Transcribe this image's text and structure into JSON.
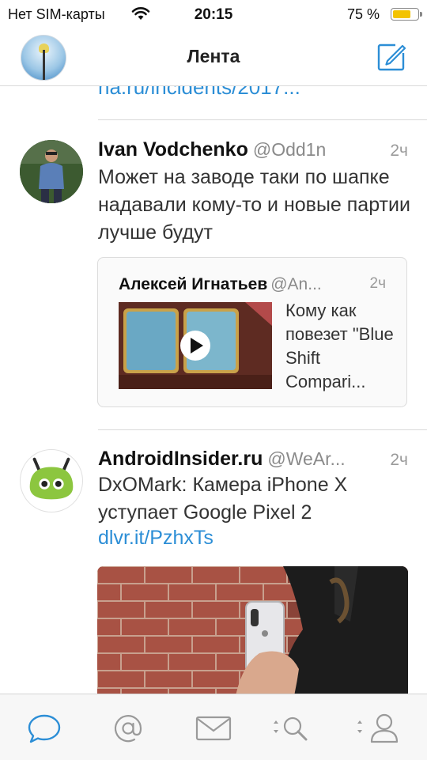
{
  "status_bar": {
    "carrier": "Нет SIM-карты",
    "time": "20:15",
    "battery_percent": "75 %",
    "battery_level": 0.75
  },
  "nav": {
    "title": "Лента"
  },
  "feed": {
    "previous_link": "na.ru/incidents/2017...",
    "tweets": [
      {
        "name": "Ivan Vodchenko",
        "handle": "@Odd1n",
        "time": "2ч",
        "text": "Может на заводе таки по шапке надавали кому-то и новые партии лучше будут",
        "quote": {
          "name": "Алексей Игнатьев",
          "handle": "@An...",
          "time": "2ч",
          "text": "Кому как повезет \"Blue Shift Compari..."
        }
      },
      {
        "name": "AndroidInsider.ru",
        "handle": "@WeAr...",
        "time": "2ч",
        "text": "DxOMark: Камера iPhone X уступает Google Pixel 2",
        "link": "dlvr.it/PzhxTs"
      }
    ]
  },
  "tab_bar": {
    "tabs": [
      "timeline",
      "mentions",
      "messages",
      "search",
      "profile"
    ]
  },
  "colors": {
    "accent": "#2c8ed6",
    "divider": "#d9d9d9"
  }
}
